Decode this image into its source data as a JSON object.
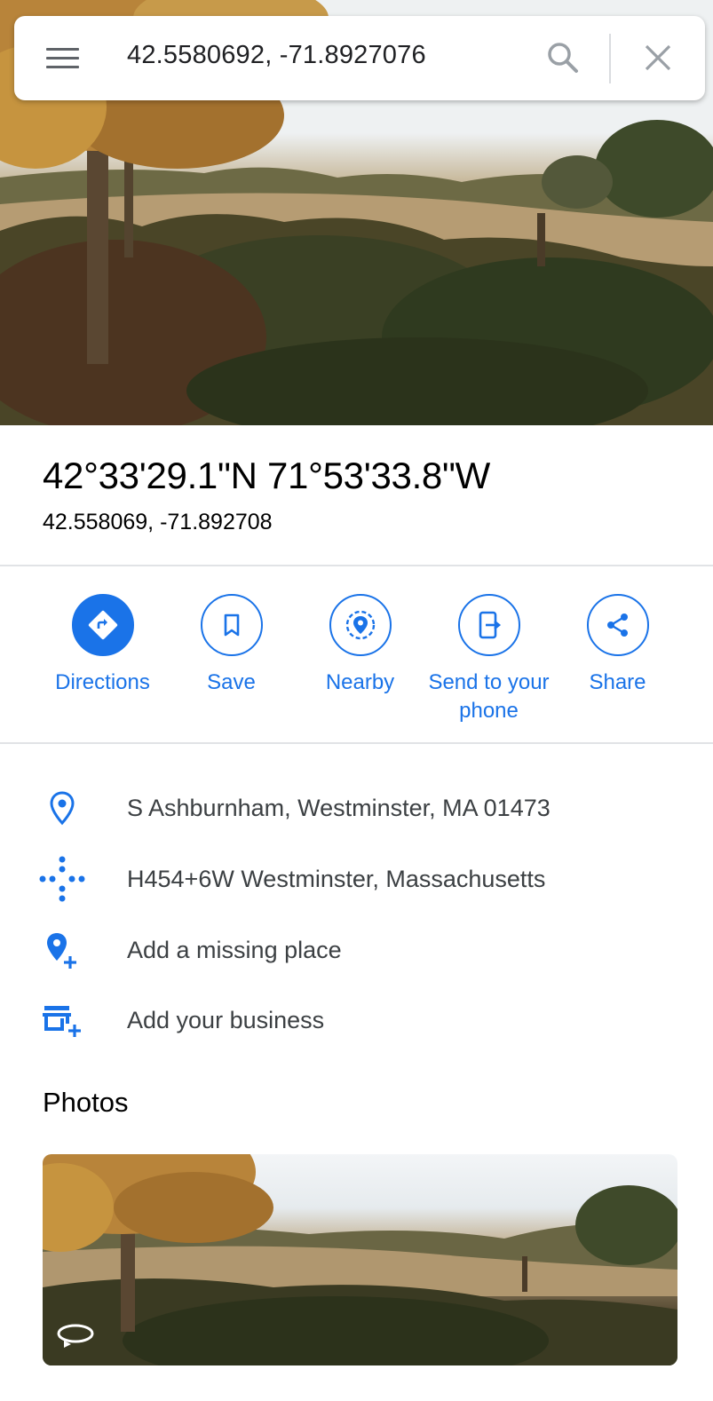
{
  "search": {
    "value": "42.5580692, -71.8927076"
  },
  "place": {
    "title": "42°33'29.1\"N 71°53'33.8\"W",
    "decimal": "42.558069, -71.892708"
  },
  "actions": [
    {
      "label": "Directions",
      "icon": "directions-icon"
    },
    {
      "label": "Save",
      "icon": "bookmark-icon"
    },
    {
      "label": "Nearby",
      "icon": "nearby-icon"
    },
    {
      "label": "Send to your phone",
      "icon": "send-to-phone-icon"
    },
    {
      "label": "Share",
      "icon": "share-icon"
    }
  ],
  "details": [
    {
      "text": "S Ashburnham, Westminster, MA 01473",
      "icon": "location-pin-icon"
    },
    {
      "text": "H454+6W Westminster, Massachusetts",
      "icon": "plus-code-icon"
    },
    {
      "text": "Add a missing place",
      "icon": "add-place-icon"
    },
    {
      "text": "Add your business",
      "icon": "add-business-icon"
    }
  ],
  "photos": {
    "heading": "Photos"
  },
  "colors": {
    "accent": "#1a73e8",
    "text": "#202124",
    "secondary_text": "#3c4043",
    "icon_gray": "#5f6368"
  }
}
